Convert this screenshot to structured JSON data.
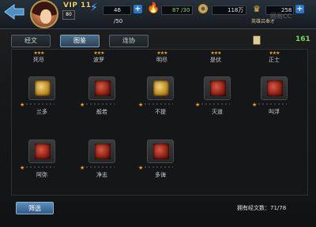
{
  "header": {
    "vip": "VIP 11",
    "level": "80",
    "energy": "46 /50",
    "stamina": "87 /30",
    "coins": "118万",
    "gold": "258",
    "title": "英雄吕奉才",
    "watermark": "网易CC"
  },
  "tabs": [
    {
      "label": "经文",
      "active": false
    },
    {
      "label": "图鉴",
      "active": true
    },
    {
      "label": "连协",
      "active": false
    }
  ],
  "book_count": "161",
  "top_row": [
    {
      "label": "死尽",
      "stars": "★★★"
    },
    {
      "label": "波罗",
      "stars": "★★★"
    },
    {
      "label": "明尽",
      "stars": "★★★"
    },
    {
      "label": "是伏",
      "stars": "★★★"
    },
    {
      "label": "正士",
      "stars": "★★★"
    }
  ],
  "cards": [
    {
      "label": "兰多",
      "emblem": "gold"
    },
    {
      "label": "般若",
      "emblem": "red"
    },
    {
      "label": "不提",
      "emblem": "gold"
    },
    {
      "label": "灭道",
      "emblem": "red"
    },
    {
      "label": "叫浮",
      "emblem": "red"
    },
    {
      "label": "阿弥",
      "emblem": "red"
    },
    {
      "label": "净志",
      "emblem": "red"
    },
    {
      "label": "多诲",
      "emblem": "red"
    }
  ],
  "filter_label": "筛选",
  "owned_text": "拥有经文数：71/78",
  "colors": {
    "accent": "#2a77c9",
    "star": "#f0a21c",
    "count": "#7cd35a",
    "gold_text": "#f2d15c"
  }
}
